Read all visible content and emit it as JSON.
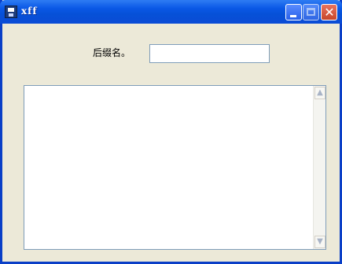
{
  "window": {
    "title": "xff",
    "app_icon": "floppy-disk-icon"
  },
  "controls": {
    "minimize_glyph": "",
    "maximize_glyph": "",
    "close_glyph": "✕"
  },
  "form": {
    "suffix_label": "后缀名。",
    "suffix_value": "",
    "output_text": ""
  },
  "scrollbar": {
    "up_glyph": "▲",
    "down_glyph": "▼"
  }
}
